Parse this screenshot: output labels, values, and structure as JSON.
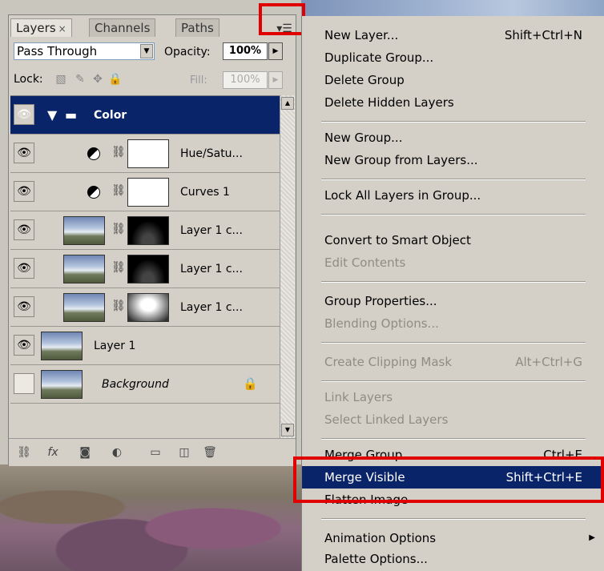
{
  "panel": {
    "tabs": [
      {
        "label": "Layers",
        "close": "×"
      },
      {
        "label": "Channels"
      },
      {
        "label": "Paths"
      }
    ],
    "blend_mode": "Pass Through",
    "opacity_label": "Opacity:",
    "opacity_value": "100%",
    "lock_label": "Lock:",
    "fill_label": "Fill:",
    "fill_value": "100%",
    "layers": [
      {
        "name": "Color",
        "type": "group",
        "selected": true
      },
      {
        "name": "Hue/Satu...",
        "type": "adjustment",
        "mask": "white"
      },
      {
        "name": "Curves 1",
        "type": "adjustment",
        "mask": "white"
      },
      {
        "name": "Layer 1 c...",
        "type": "pixel",
        "mask": "black"
      },
      {
        "name": "Layer 1 c...",
        "type": "pixel",
        "mask": "black"
      },
      {
        "name": "Layer 1 c...",
        "type": "pixel",
        "mask": "gradient"
      },
      {
        "name": "Layer 1",
        "type": "pixel"
      },
      {
        "name": "Background",
        "type": "background",
        "locked": true,
        "hidden": true
      }
    ]
  },
  "menu": {
    "items": [
      {
        "label": "New Layer...",
        "shortcut": "Shift+Ctrl+N"
      },
      {
        "label": "Duplicate Group..."
      },
      {
        "label": "Delete Group"
      },
      {
        "label": "Delete Hidden Layers"
      },
      {
        "label": "New Group..."
      },
      {
        "label": "New Group from Layers..."
      },
      {
        "label": "Lock All Layers in Group..."
      },
      {
        "label": "Convert to Smart Object"
      },
      {
        "label": "Edit Contents",
        "disabled": true
      },
      {
        "label": "Group Properties..."
      },
      {
        "label": "Blending Options...",
        "disabled": true
      },
      {
        "label": "Create Clipping Mask",
        "shortcut": "Alt+Ctrl+G",
        "disabled": true
      },
      {
        "label": "Link Layers",
        "disabled": true
      },
      {
        "label": "Select Linked Layers",
        "disabled": true
      },
      {
        "label": "Merge Group",
        "shortcut": "Ctrl+E"
      },
      {
        "label": "Merge Visible",
        "shortcut": "Shift+Ctrl+E",
        "active": true
      },
      {
        "label": "Flatten Image"
      },
      {
        "label": "Animation Options",
        "submenu": true
      },
      {
        "label": "Palette Options..."
      }
    ]
  },
  "colors": {
    "selection": "#0a246a",
    "annotation": "#e00000",
    "panel_bg": "#d4d0c8",
    "disabled_text": "#8f8c84"
  }
}
